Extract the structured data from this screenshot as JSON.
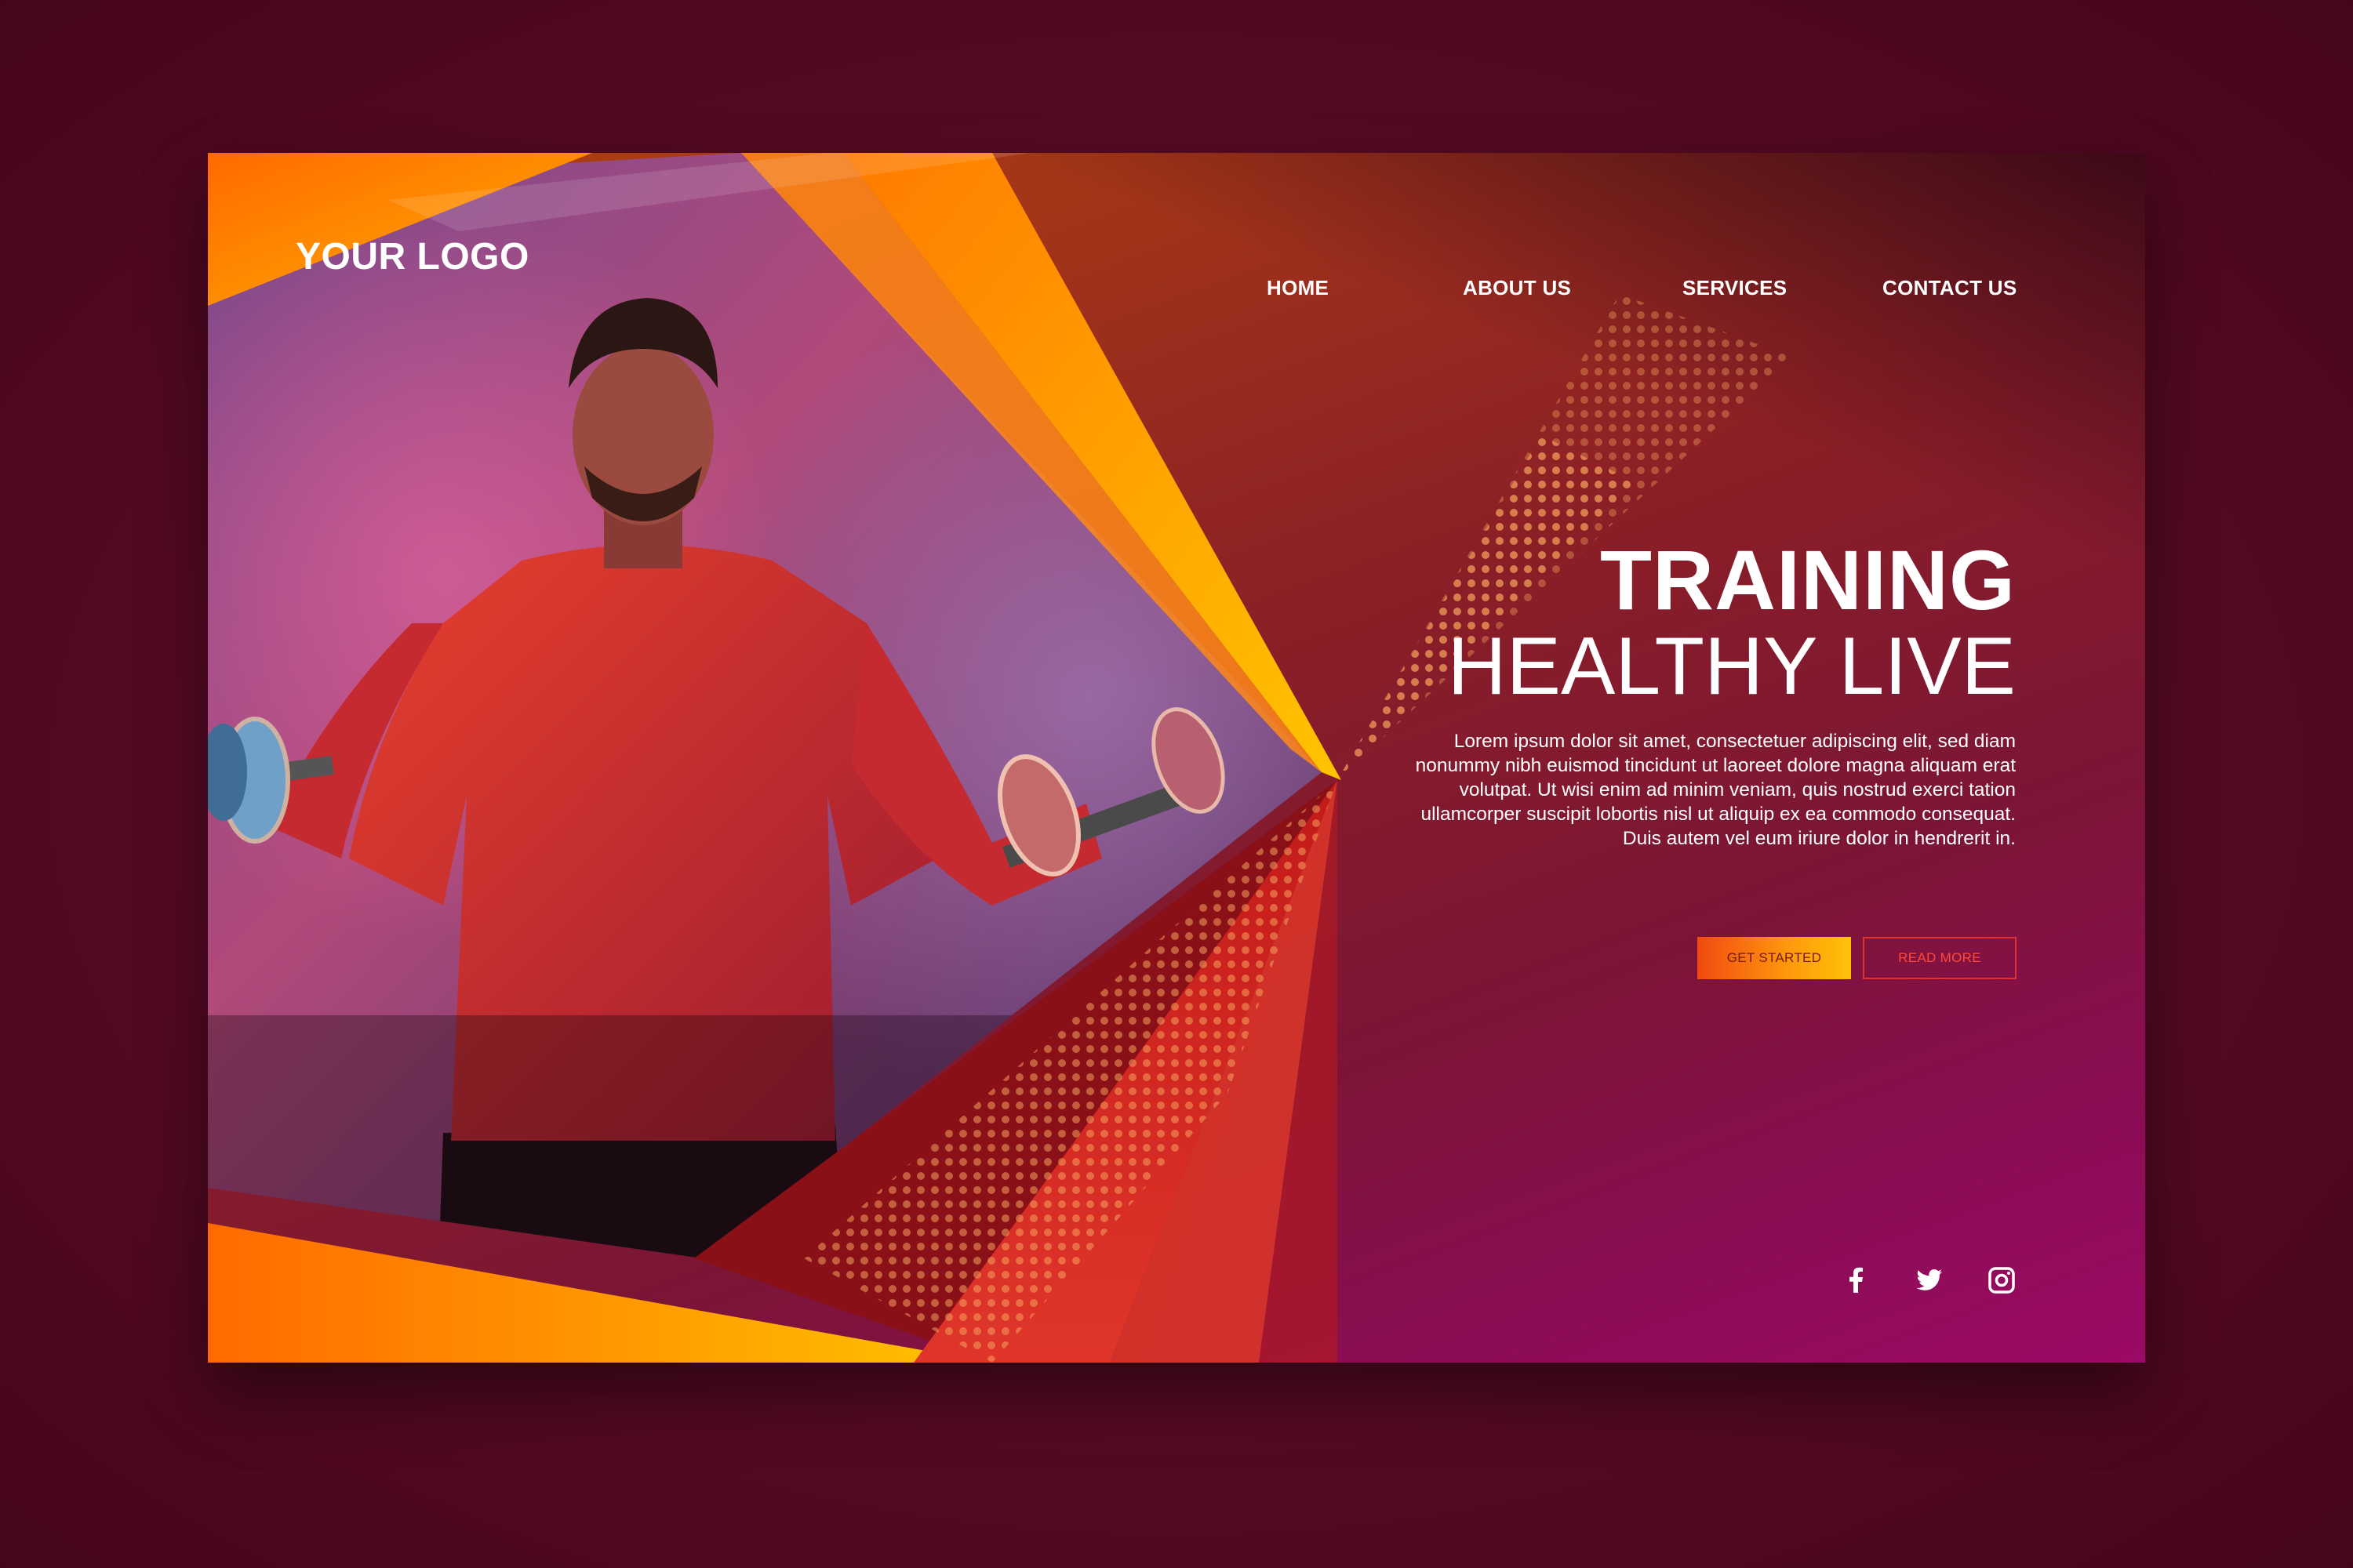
{
  "header": {
    "logo": "YOUR LOGO",
    "nav": {
      "home": "HOME",
      "about": "ABOUT US",
      "services": "SERVICES",
      "contact": "CONTACT US"
    }
  },
  "hero": {
    "title": "TRAINING",
    "subtitle": "HEALTHY LIVE",
    "description": "Lorem ipsum dolor sit amet, consectetuer adipiscing elit, sed diam nonummy nibh euismod tincidunt ut laoreet dolore magna aliquam erat volutpat. Ut wisi enim ad minim veniam, quis nostrud exerci tation ullamcorper suscipit lobortis nisl ut aliquip ex ea commodo consequat. Duis autem vel eum iriure dolor in hendrerit in.",
    "buttons": {
      "primary": "GET STARTED",
      "secondary": "READ MORE"
    },
    "image": "man-lifting-dumbbells-photo"
  },
  "social": {
    "icons": [
      "facebook-icon",
      "twitter-icon",
      "instagram-icon"
    ]
  },
  "colors": {
    "background": "#560a24",
    "accent_orange": "#ff8a00",
    "accent_yellow": "#ffc107",
    "accent_red": "#e0332f",
    "text": "#ffffff"
  }
}
